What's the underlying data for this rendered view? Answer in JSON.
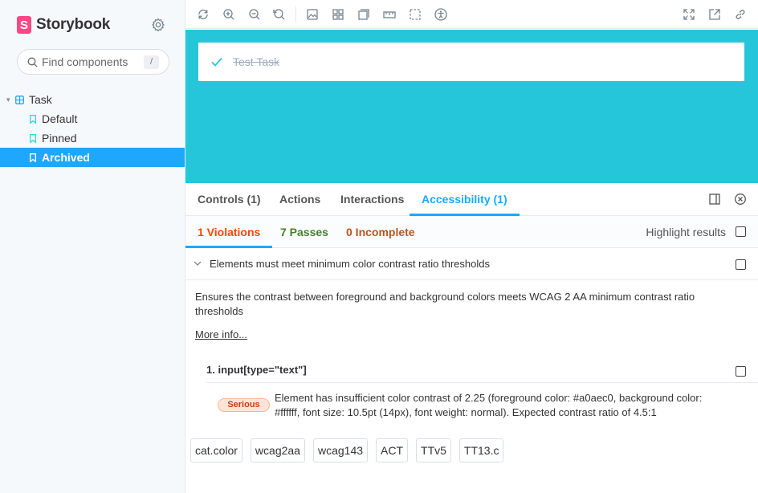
{
  "sidebar": {
    "brand": "Storybook",
    "search_placeholder": "Find components",
    "search_shortcut": "/",
    "tree": {
      "component": "Task",
      "stories": [
        {
          "label": "Default",
          "selected": false
        },
        {
          "label": "Pinned",
          "selected": false
        },
        {
          "label": "Archived",
          "selected": true
        }
      ]
    }
  },
  "preview": {
    "task_title": "Test Task",
    "background_color": "#26c6da"
  },
  "addons": {
    "tabs": [
      {
        "label": "Controls (1)"
      },
      {
        "label": "Actions"
      },
      {
        "label": "Interactions"
      },
      {
        "label": "Accessibility (1)"
      }
    ],
    "a11y": {
      "subtabs": {
        "violations": "1 Violations",
        "passes": "7 Passes",
        "incomplete": "0 Incomplete"
      },
      "highlight_label": "Highlight results",
      "rule_title": "Elements must meet minimum color contrast ratio thresholds",
      "rule_description": "Ensures the contrast between foreground and background colors meets WCAG 2 AA minimum contrast ratio thresholds",
      "more_info": "More info...",
      "element_title": "1. input[type=\"text\"]",
      "impact": "Serious",
      "element_description": "Element has insufficient color contrast of 2.25 (foreground color: #a0aec0, background color: #ffffff, font size: 10.5pt (14px), font weight: normal). Expected contrast ratio of 4.5:1",
      "tags": [
        "cat.color",
        "wcag2aa",
        "wcag143",
        "ACT",
        "TTv5",
        "TT13.c"
      ]
    }
  },
  "colors": {
    "accent": "#1ea7fd",
    "brand": "#ff4785",
    "violations": "#ff4400",
    "passes": "#448028",
    "incomplete": "#b6561c"
  }
}
